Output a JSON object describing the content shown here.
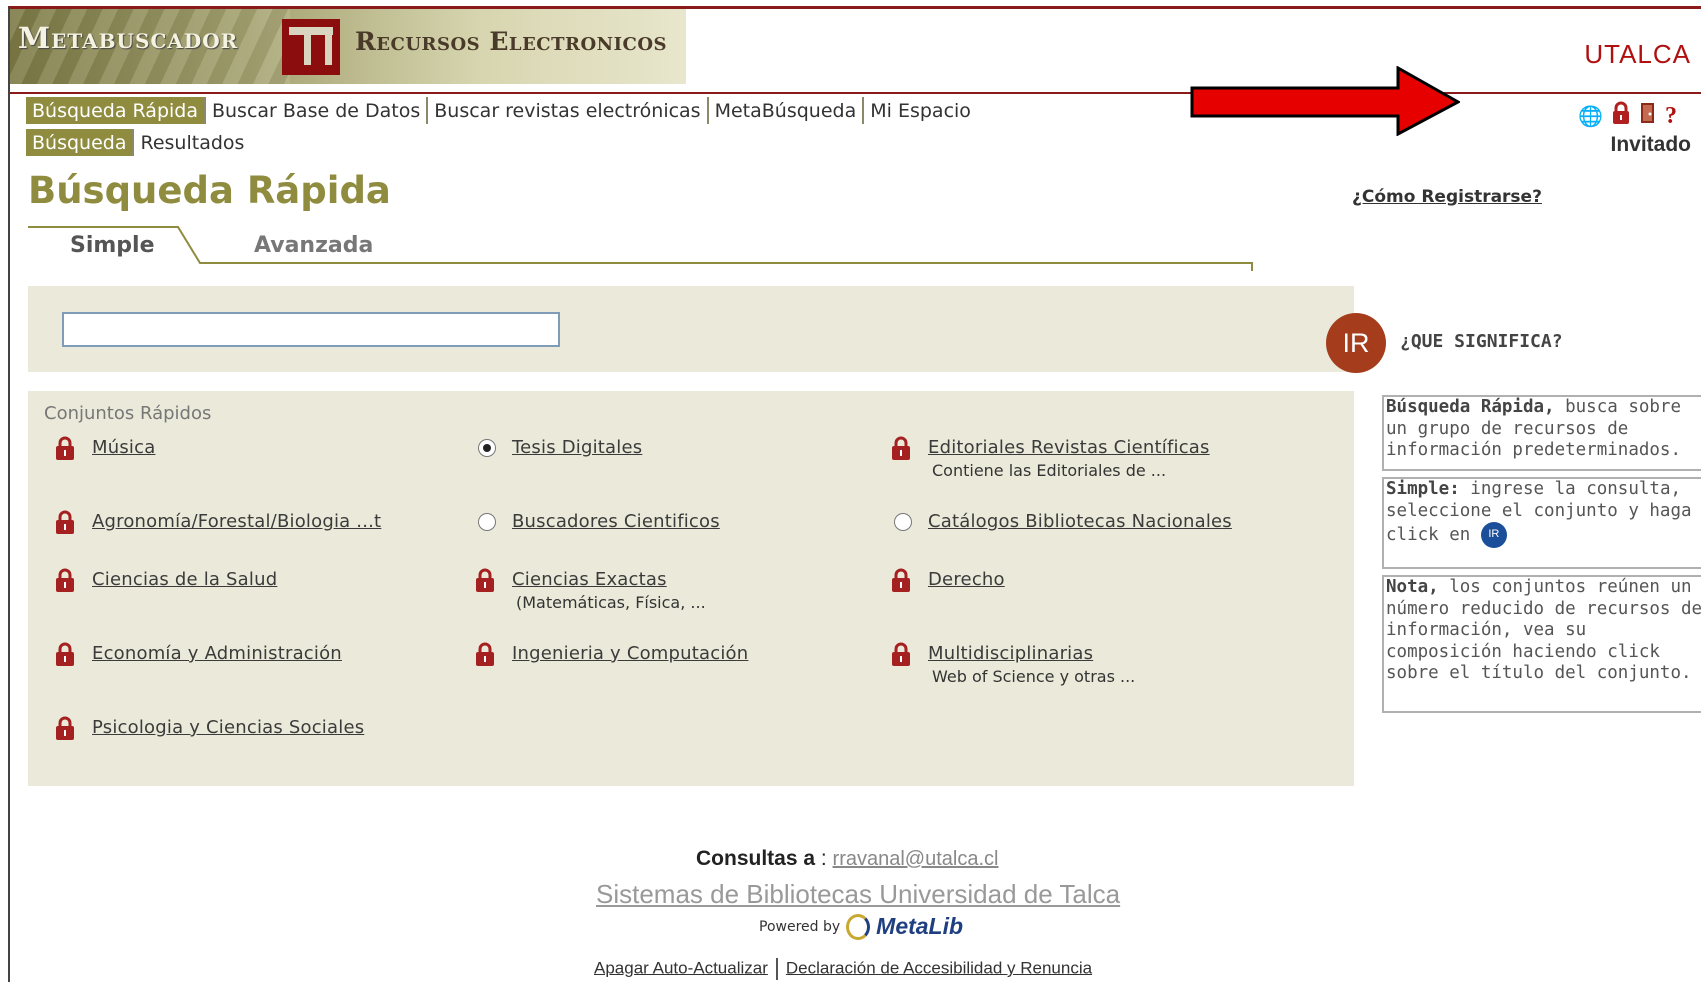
{
  "header": {
    "brand_left": "Metabuscador",
    "brand_right": "Recursos Electronicos",
    "institution": "UTALCA",
    "user_label": "Invitado",
    "icons": [
      "globe-icon",
      "lock-icon",
      "exit-door-icon",
      "help-icon"
    ]
  },
  "nav": {
    "primary": [
      "Búsqueda Rápida",
      "Buscar Base de Datos",
      "Buscar revistas electrónicas",
      "MetaBúsqueda",
      "Mi Espacio"
    ],
    "secondary": [
      "Búsqueda",
      "Resultados"
    ]
  },
  "page": {
    "title": "Búsqueda Rápida",
    "register_link": "¿Cómo Registrarse?"
  },
  "tabs": [
    "Simple",
    "Avanzada"
  ],
  "search": {
    "value": "",
    "placeholder": ""
  },
  "info": {
    "badge": "IR",
    "question": "¿QUE SIGNIFICA?"
  },
  "sets": {
    "title": "Conjuntos Rápidos",
    "items": [
      {
        "name": "Música",
        "desc": "",
        "icon": "lock"
      },
      {
        "name": "Tesis Digitales",
        "desc": "",
        "icon": "radio-selected"
      },
      {
        "name": "Editoriales Revistas Científicas",
        "desc": "Contiene las Editoriales de ...",
        "icon": "lock"
      },
      {
        "name": "Agronomía/Forestal/Biologia ...t",
        "desc": "",
        "icon": "lock"
      },
      {
        "name": "Buscadores Cientificos",
        "desc": "",
        "icon": "radio"
      },
      {
        "name": "Catálogos Bibliotecas Nacionales",
        "desc": "",
        "icon": "radio"
      },
      {
        "name": "Ciencias de la Salud",
        "desc": "",
        "icon": "lock"
      },
      {
        "name": "Ciencias Exactas",
        "desc": "(Matemáticas, Física, ...",
        "icon": "lock"
      },
      {
        "name": "Derecho",
        "desc": "",
        "icon": "lock"
      },
      {
        "name": "Economía y Administración",
        "desc": "",
        "icon": "lock"
      },
      {
        "name": "Ingenieria y Computación",
        "desc": "",
        "icon": "lock"
      },
      {
        "name": "Multidisciplinarias",
        "desc": "Web of Science y otras ...",
        "icon": "lock"
      },
      {
        "name": "Psicologia y Ciencias Sociales",
        "desc": "",
        "icon": "lock"
      }
    ]
  },
  "help": {
    "box1_bold": "Búsqueda Rápida,",
    "box1_text": " busca sobre un grupo de recursos de información predeterminados.",
    "box2_bold": "Simple:",
    "box2_text": " ingrese la consulta, seleccione el conjunto y haga click en",
    "box2_badge": "IR",
    "box3_bold": "Nota,",
    "box3_text": " los conjuntos reúnen un número reducido de recursos de información, vea su composición haciendo click sobre el título del conjunto."
  },
  "footer": {
    "consultas_label": "Consultas a",
    "consultas_sep": " : ",
    "email": "rravanal@utalca.cl",
    "library": "Sistemas de Bibliotecas Universidad de Talca",
    "powered_by": "Powered by",
    "product": "MetaLib",
    "link1": "Apagar Auto-Actualizar",
    "link2": "Declaración de Accesibilidad y Renuncia"
  },
  "colors": {
    "accent_olive": "#8f8c3f",
    "panel_bg": "#ebeada",
    "brand_red": "#b01010",
    "ir_badge": "#a53d1c",
    "arrow_red": "#e60000"
  }
}
